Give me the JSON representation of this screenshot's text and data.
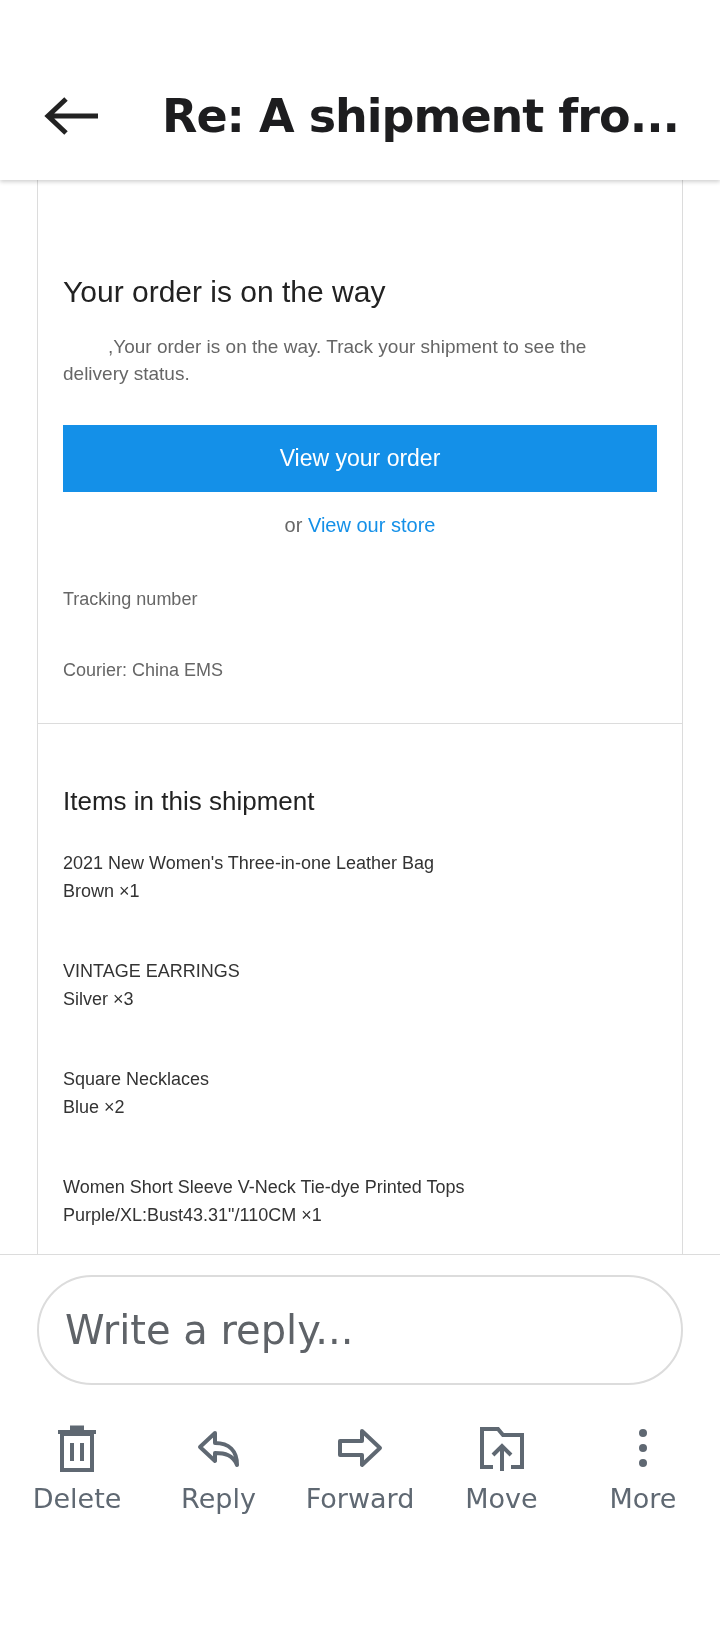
{
  "header": {
    "title": "Re: A shipment fro..."
  },
  "message": {
    "heading": "Your order is on the way",
    "greeting": ",Your order is on the way. Track your shipment to see the delivery status.",
    "primary_button": "View your order",
    "alt_prefix": "or",
    "alt_link": "View our store",
    "tracking_label": "Tracking number",
    "courier": "Courier: China EMS"
  },
  "shipment": {
    "heading": "Items in this shipment",
    "items": [
      {
        "name": "2021 New Women's Three-in-one Leather Bag",
        "variant": "Brown ×1"
      },
      {
        "name": "VINTAGE EARRINGS",
        "variant": "Silver ×3"
      },
      {
        "name": "Square Necklaces",
        "variant": "Blue ×2"
      },
      {
        "name": "Women Short Sleeve V-Neck Tie-dye Printed Tops",
        "variant": "Purple/XL:Bust43.31\"/110CM ×1"
      }
    ]
  },
  "reply": {
    "placeholder": "Write a reply..."
  },
  "actions": [
    {
      "kind": "delete",
      "label": "Delete"
    },
    {
      "kind": "reply",
      "label": "Reply"
    },
    {
      "kind": "forward",
      "label": "Forward"
    },
    {
      "kind": "move",
      "label": "Move"
    },
    {
      "kind": "more",
      "label": "More"
    }
  ]
}
